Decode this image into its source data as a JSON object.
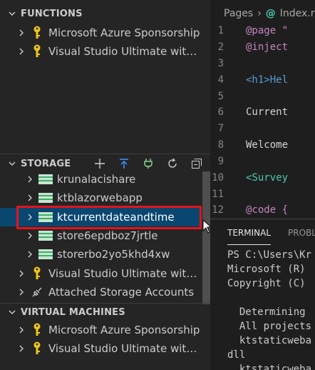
{
  "sidebar": {
    "functions": {
      "title": "FUNCTIONS",
      "items": [
        {
          "label": "Microsoft Azure Sponsorship",
          "icon": "key-icon"
        },
        {
          "label": "Visual Studio Ultimate with ...",
          "icon": "key-icon"
        }
      ]
    },
    "storage": {
      "title": "STORAGE",
      "actions": [
        "add-icon",
        "deploy-icon",
        "plug-icon",
        "refresh-icon",
        "collapse-all-icon"
      ],
      "items": [
        {
          "label": "krunalacishare",
          "icon": "storage-account-icon",
          "indent": 1
        },
        {
          "label": "ktblazorwebapp",
          "icon": "storage-account-icon",
          "indent": 1
        },
        {
          "label": "ktcurrentdateandtime",
          "icon": "storage-account-icon",
          "indent": 1,
          "selected": true
        },
        {
          "label": "store6epdboz7jrtle",
          "icon": "storage-account-icon",
          "indent": 1
        },
        {
          "label": "storerbo2yo5khd4xw",
          "icon": "storage-account-icon",
          "indent": 1
        },
        {
          "label": "Visual Studio Ultimate with ...",
          "icon": "key-icon",
          "indent": 0
        },
        {
          "label": "Attached Storage Accounts",
          "icon": "plug-icon",
          "indent": 0
        }
      ]
    },
    "virtual_machines": {
      "title": "VIRTUAL MACHINES",
      "items": [
        {
          "label": "Microsoft Azure Sponsorship",
          "icon": "key-icon"
        },
        {
          "label": "Visual Studio Ultimate with ...",
          "icon": "key-icon"
        }
      ]
    }
  },
  "editor": {
    "breadcrumb": {
      "folder": "Pages",
      "file": "Index.r"
    },
    "lines": [
      {
        "n": "1",
        "text": "@page \""
      },
      {
        "n": "2",
        "text": "@inject"
      },
      {
        "n": "3",
        "text": ""
      },
      {
        "n": "4",
        "text": "<h1>Hel"
      },
      {
        "n": "5",
        "text": ""
      },
      {
        "n": "6",
        "text": "Current"
      },
      {
        "n": "7",
        "text": ""
      },
      {
        "n": "8",
        "text": "Welcome"
      },
      {
        "n": "9",
        "text": ""
      },
      {
        "n": "10",
        "text": "<Survey"
      },
      {
        "n": "11",
        "text": ""
      },
      {
        "n": "12",
        "text": "@code {"
      }
    ]
  },
  "panel": {
    "tabs": {
      "terminal": "TERMINAL",
      "problems": "PROBLE"
    },
    "terminal_lines": [
      "PS C:\\Users\\Kr",
      "Microsoft (R)",
      "Copyright (C)",
      "",
      "  Determining",
      "  All projects",
      "  ktstaticweba",
      "dll",
      "  ktstaticweba"
    ]
  },
  "colors": {
    "accent_selection": "#094771",
    "highlight": "#e5131c",
    "key_icon": "#f0c419",
    "storage_icon": "#c8e6d2",
    "action_icon": "#3794ff",
    "plug_icon": "#89d185"
  }
}
